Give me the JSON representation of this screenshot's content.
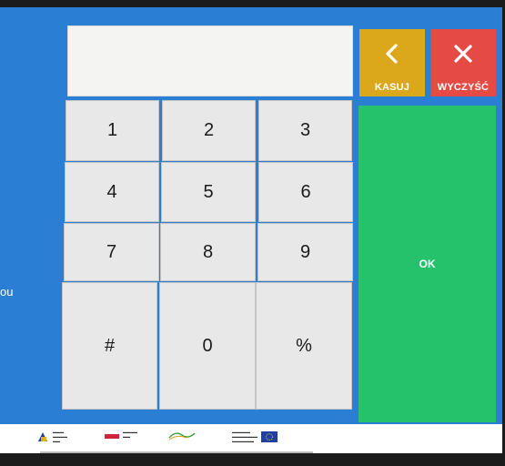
{
  "display": {
    "value": ""
  },
  "buttons": {
    "kasuj": {
      "label": "KASUJ",
      "icon": "chevron-left-icon"
    },
    "clear": {
      "label": "WYCZYŚĆ",
      "icon": "close-icon"
    },
    "ok": {
      "label": "OK"
    }
  },
  "keypad": {
    "k1": "1",
    "k2": "2",
    "k3": "3",
    "k4": "4",
    "k5": "5",
    "k6": "6",
    "k7": "7",
    "k8": "8",
    "k9": "9",
    "hash": "#",
    "k0": "0",
    "percent": "%"
  },
  "side_text": "ou",
  "colors": {
    "screen": "#2a7fd4",
    "kasuj": "#dca81b",
    "clear": "#e64a45",
    "ok": "#26c26b",
    "key": "#e8e8e8"
  }
}
